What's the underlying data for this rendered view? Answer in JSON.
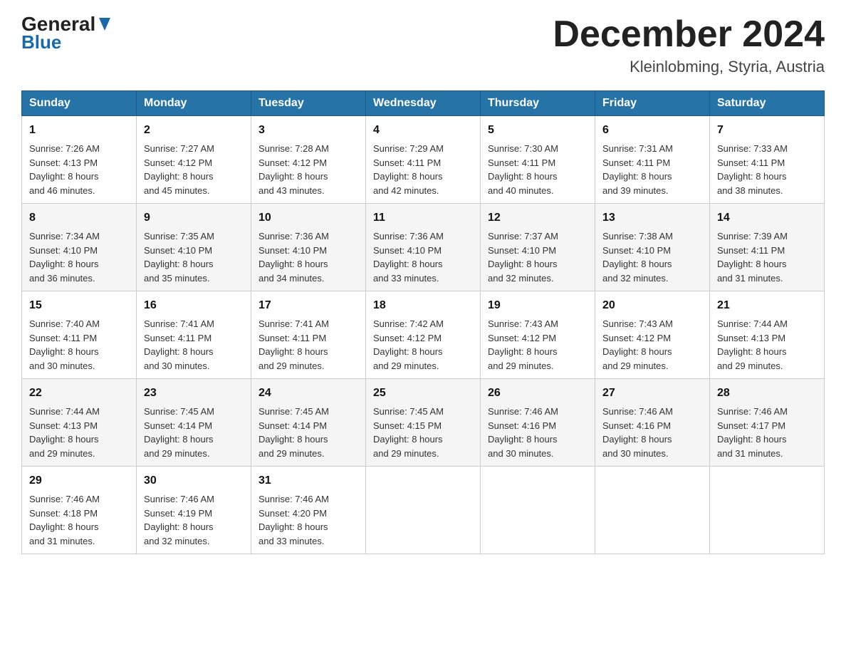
{
  "header": {
    "month_title": "December 2024",
    "location": "Kleinlobming, Styria, Austria",
    "logo_general": "General",
    "logo_blue": "Blue"
  },
  "days_of_week": [
    "Sunday",
    "Monday",
    "Tuesday",
    "Wednesday",
    "Thursday",
    "Friday",
    "Saturday"
  ],
  "weeks": [
    [
      {
        "num": "1",
        "sunrise": "7:26 AM",
        "sunset": "4:13 PM",
        "daylight": "8 hours and 46 minutes."
      },
      {
        "num": "2",
        "sunrise": "7:27 AM",
        "sunset": "4:12 PM",
        "daylight": "8 hours and 45 minutes."
      },
      {
        "num": "3",
        "sunrise": "7:28 AM",
        "sunset": "4:12 PM",
        "daylight": "8 hours and 43 minutes."
      },
      {
        "num": "4",
        "sunrise": "7:29 AM",
        "sunset": "4:11 PM",
        "daylight": "8 hours and 42 minutes."
      },
      {
        "num": "5",
        "sunrise": "7:30 AM",
        "sunset": "4:11 PM",
        "daylight": "8 hours and 40 minutes."
      },
      {
        "num": "6",
        "sunrise": "7:31 AM",
        "sunset": "4:11 PM",
        "daylight": "8 hours and 39 minutes."
      },
      {
        "num": "7",
        "sunrise": "7:33 AM",
        "sunset": "4:11 PM",
        "daylight": "8 hours and 38 minutes."
      }
    ],
    [
      {
        "num": "8",
        "sunrise": "7:34 AM",
        "sunset": "4:10 PM",
        "daylight": "8 hours and 36 minutes."
      },
      {
        "num": "9",
        "sunrise": "7:35 AM",
        "sunset": "4:10 PM",
        "daylight": "8 hours and 35 minutes."
      },
      {
        "num": "10",
        "sunrise": "7:36 AM",
        "sunset": "4:10 PM",
        "daylight": "8 hours and 34 minutes."
      },
      {
        "num": "11",
        "sunrise": "7:36 AM",
        "sunset": "4:10 PM",
        "daylight": "8 hours and 33 minutes."
      },
      {
        "num": "12",
        "sunrise": "7:37 AM",
        "sunset": "4:10 PM",
        "daylight": "8 hours and 32 minutes."
      },
      {
        "num": "13",
        "sunrise": "7:38 AM",
        "sunset": "4:10 PM",
        "daylight": "8 hours and 32 minutes."
      },
      {
        "num": "14",
        "sunrise": "7:39 AM",
        "sunset": "4:11 PM",
        "daylight": "8 hours and 31 minutes."
      }
    ],
    [
      {
        "num": "15",
        "sunrise": "7:40 AM",
        "sunset": "4:11 PM",
        "daylight": "8 hours and 30 minutes."
      },
      {
        "num": "16",
        "sunrise": "7:41 AM",
        "sunset": "4:11 PM",
        "daylight": "8 hours and 30 minutes."
      },
      {
        "num": "17",
        "sunrise": "7:41 AM",
        "sunset": "4:11 PM",
        "daylight": "8 hours and 29 minutes."
      },
      {
        "num": "18",
        "sunrise": "7:42 AM",
        "sunset": "4:12 PM",
        "daylight": "8 hours and 29 minutes."
      },
      {
        "num": "19",
        "sunrise": "7:43 AM",
        "sunset": "4:12 PM",
        "daylight": "8 hours and 29 minutes."
      },
      {
        "num": "20",
        "sunrise": "7:43 AM",
        "sunset": "4:12 PM",
        "daylight": "8 hours and 29 minutes."
      },
      {
        "num": "21",
        "sunrise": "7:44 AM",
        "sunset": "4:13 PM",
        "daylight": "8 hours and 29 minutes."
      }
    ],
    [
      {
        "num": "22",
        "sunrise": "7:44 AM",
        "sunset": "4:13 PM",
        "daylight": "8 hours and 29 minutes."
      },
      {
        "num": "23",
        "sunrise": "7:45 AM",
        "sunset": "4:14 PM",
        "daylight": "8 hours and 29 minutes."
      },
      {
        "num": "24",
        "sunrise": "7:45 AM",
        "sunset": "4:14 PM",
        "daylight": "8 hours and 29 minutes."
      },
      {
        "num": "25",
        "sunrise": "7:45 AM",
        "sunset": "4:15 PM",
        "daylight": "8 hours and 29 minutes."
      },
      {
        "num": "26",
        "sunrise": "7:46 AM",
        "sunset": "4:16 PM",
        "daylight": "8 hours and 30 minutes."
      },
      {
        "num": "27",
        "sunrise": "7:46 AM",
        "sunset": "4:16 PM",
        "daylight": "8 hours and 30 minutes."
      },
      {
        "num": "28",
        "sunrise": "7:46 AM",
        "sunset": "4:17 PM",
        "daylight": "8 hours and 31 minutes."
      }
    ],
    [
      {
        "num": "29",
        "sunrise": "7:46 AM",
        "sunset": "4:18 PM",
        "daylight": "8 hours and 31 minutes."
      },
      {
        "num": "30",
        "sunrise": "7:46 AM",
        "sunset": "4:19 PM",
        "daylight": "8 hours and 32 minutes."
      },
      {
        "num": "31",
        "sunrise": "7:46 AM",
        "sunset": "4:20 PM",
        "daylight": "8 hours and 33 minutes."
      },
      null,
      null,
      null,
      null
    ]
  ],
  "labels": {
    "sunrise": "Sunrise:",
    "sunset": "Sunset:",
    "daylight": "Daylight:"
  }
}
